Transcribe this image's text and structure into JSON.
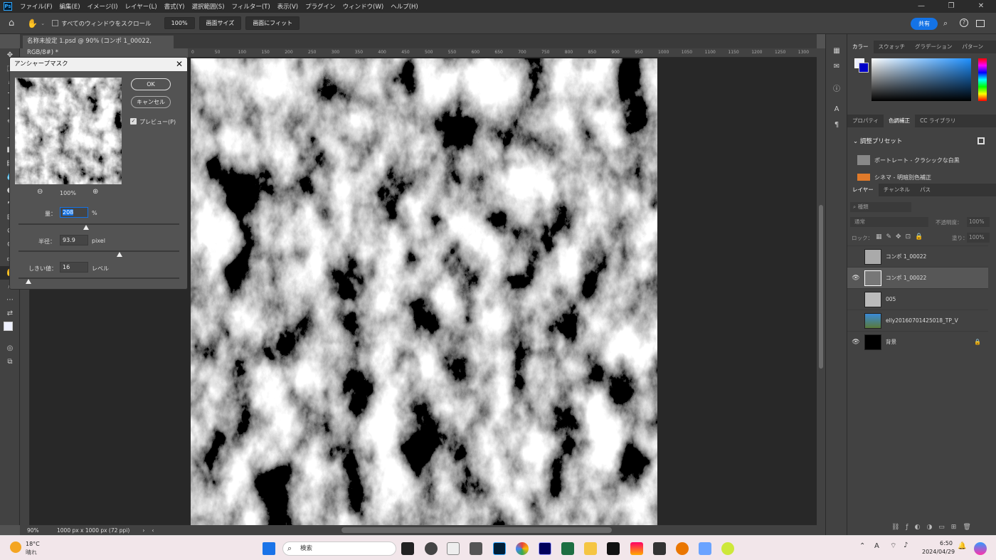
{
  "app": {
    "logo": "Ps"
  },
  "menu": [
    "ファイル(F)",
    "編集(E)",
    "イメージ(I)",
    "レイヤー(L)",
    "書式(Y)",
    "選択範囲(S)",
    "フィルター(T)",
    "表示(V)",
    "プラグイン",
    "ウィンドウ(W)",
    "ヘルプ(H)"
  ],
  "window_controls": {
    "minimize": "—",
    "maximize": "❐",
    "close": "✕"
  },
  "options": {
    "scroll_all_label": "すべてのウィンドウをスクロール",
    "zoom": "100%",
    "screen_size": "画面サイズ",
    "fit_screen": "画面にフィット",
    "share": "共有"
  },
  "document": {
    "tab_title": "名称未設定 1.psd @ 90% (コンポ 1_00022, RGB/8#) *",
    "zoom": "90%",
    "size_info": "1000 px x 1000 px (72 ppi)"
  },
  "ruler_ticks": [
    "0",
    "50",
    "100",
    "150",
    "200",
    "250",
    "300",
    "350",
    "400",
    "450",
    "500",
    "550",
    "600",
    "650",
    "700",
    "750",
    "800",
    "850",
    "900",
    "950",
    "1000",
    "1050",
    "1100",
    "1150",
    "1200",
    "1250",
    "1300"
  ],
  "dialog": {
    "title": "アンシャープマスク",
    "ok": "OK",
    "cancel": "キャンセル",
    "preview_label": "プレビュー(P)",
    "preview_checked": true,
    "preview_zoom": "100%",
    "amount_label": "量：",
    "amount_value": "208",
    "amount_unit": "%",
    "amount_level": 0.42,
    "radius_label": "半径：",
    "radius_value": "93.9",
    "radius_unit": "pixel",
    "radius_level": 0.63,
    "threshold_label": "しきい値：",
    "threshold_value": "16",
    "threshold_unit": "レベル",
    "threshold_level": 0.06
  },
  "panels": {
    "color_tabs": [
      "カラー",
      "スウォッチ",
      "グラデーション",
      "パターン"
    ],
    "props_tabs": [
      "プロパティ",
      "色調補正",
      "CC ライブラリ"
    ],
    "preset_header": "調整プリセット",
    "presets": [
      "ポートレート - クラシックな白黒",
      "シネマ - 明暗別色補正"
    ],
    "layers_tabs": [
      "レイヤー",
      "チャンネル",
      "パス"
    ],
    "layer_search": "種類",
    "blend_mode": "通常",
    "opacity_label": "不透明度：",
    "opacity_value": "100%",
    "lock_label": "ロック：",
    "fill_label": "塗り：",
    "fill_value": "100%",
    "layers": [
      {
        "name": "コンポ 1_00022",
        "visible": false,
        "selected": false
      },
      {
        "name": "コンポ 1_00022",
        "visible": true,
        "selected": true
      },
      {
        "name": "005",
        "visible": false,
        "selected": false
      },
      {
        "name": "elly20160701425018_TP_V",
        "visible": false,
        "selected": false
      },
      {
        "name": "背景",
        "visible": true,
        "selected": false,
        "locked": true
      }
    ]
  },
  "taskbar": {
    "weather_temp": "18°C",
    "weather_desc": "晴れ",
    "search_placeholder": "検索",
    "time": "6:50",
    "date": "2024/04/29",
    "ime": "A"
  },
  "colors": {
    "fg": "#eef0ff",
    "bg": "#0000c8",
    "accent": "#1473e6"
  }
}
